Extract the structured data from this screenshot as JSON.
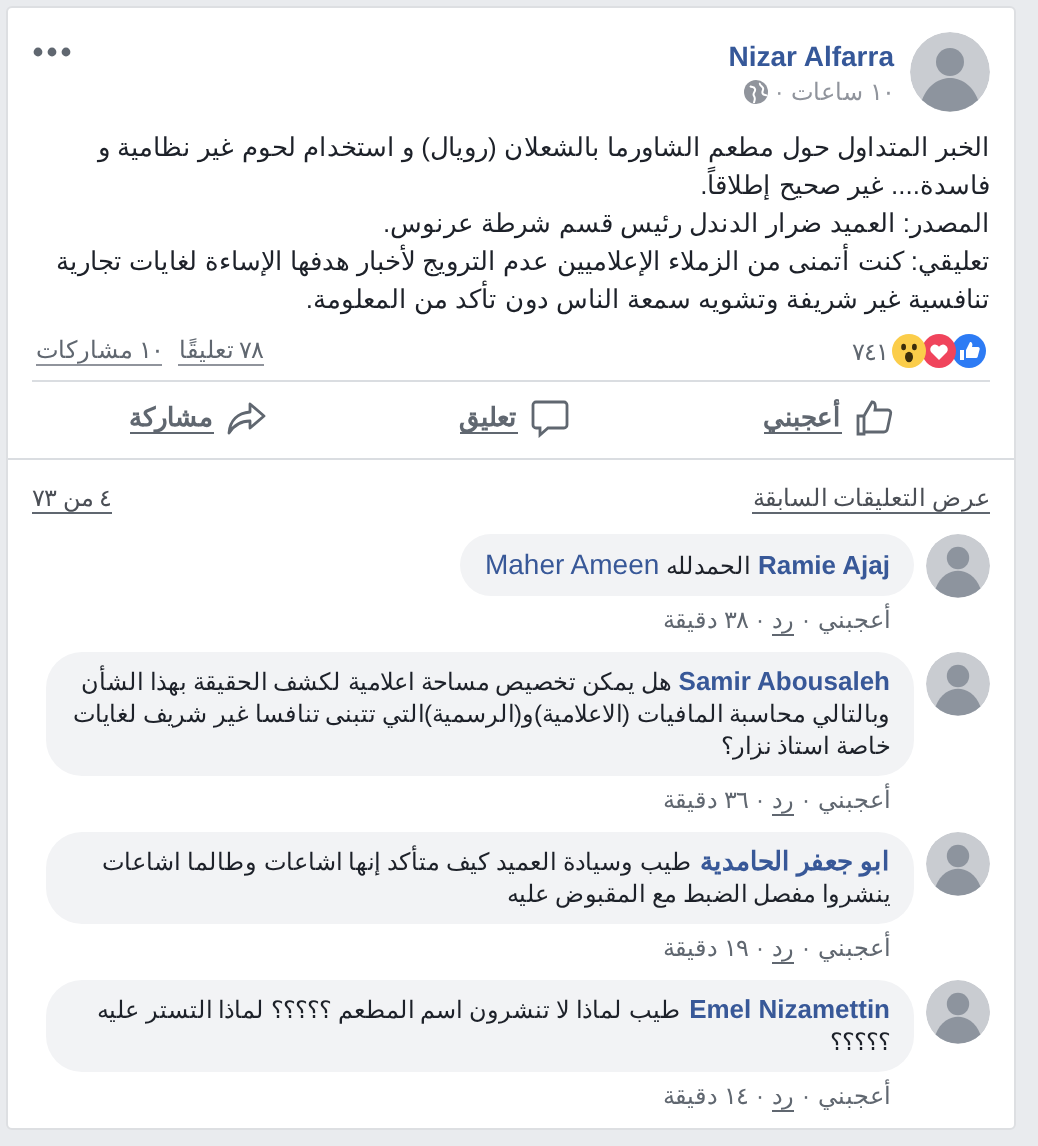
{
  "post": {
    "author": "Nizar Alfarra",
    "time": "١٠ ساعات",
    "separator": "·",
    "paragraphs": [
      "الخبر المتداول حول مطعم الشاورما بالشعلان (رويال) و استخدام لحوم غير نظامية و فاسدة.... غير صحيح إطلاقاً.",
      "المصدر: العميد ضرار الدندل رئيس قسم شرطة عرنوس.",
      "تعليقي: كنت أتمنى من الزملاء الإعلاميين عدم الترويج لأخبار هدفها الإساءة لغايات تجارية تنافسية غير شريفة وتشويه سمعة الناس دون تأكد من المعلومة."
    ],
    "reactions": [
      {
        "kind": "like"
      },
      {
        "kind": "love"
      },
      {
        "kind": "wow"
      }
    ],
    "reaction_count": "٧٤١",
    "comments_count": "٧٨ تعليقًا",
    "shares_count": "١٠ مشاركات",
    "actions": [
      {
        "kind": "like",
        "label": "أعجبني"
      },
      {
        "kind": "comment",
        "label": "تعليق"
      },
      {
        "kind": "share",
        "label": "مشاركة"
      }
    ]
  },
  "comments_header": {
    "view_previous": "عرض التعليقات السابقة",
    "count": "٤ من ٧٣"
  },
  "comments": [
    {
      "author": "Ramie Ajaj",
      "text": "الحمدلله",
      "mention": "Maher Ameen",
      "like": "أعجبني",
      "separator": "·",
      "reply": "رد",
      "time": "٣٨ دقيقة"
    },
    {
      "author": "Samir Abousaleh",
      "text": "هل يمكن تخصيص مساحة اعلامية لكشف الحقيقة بهذا الشأن وبالتالي محاسبة المافيات (الاعلامية)و(الرسمية)التي تتبنى تنافسا غير شريف لغايات خاصة استاذ نزار؟",
      "like": "أعجبني",
      "separator": "·",
      "reply": "رد",
      "time": "٣٦ دقيقة"
    },
    {
      "author": "ابو جعفر الحامدية",
      "text": "طيب وسيادة العميد كيف متأكد إنها اشاعات وطالما اشاعات ينشروا مفصل الضبط مع المقبوض عليه",
      "like": "أعجبني",
      "separator": "·",
      "reply": "رد",
      "time": "١٩ دقيقة"
    },
    {
      "author": "Emel Nizamettin",
      "text": "طيب لماذا لا تنشرون اسم المطعم ؟؟؟؟؟ لماذا التستر عليه ؟؟؟؟؟",
      "like": "أعجبني",
      "separator": "·",
      "reply": "رد",
      "time": "١٤ دقيقة"
    }
  ]
}
